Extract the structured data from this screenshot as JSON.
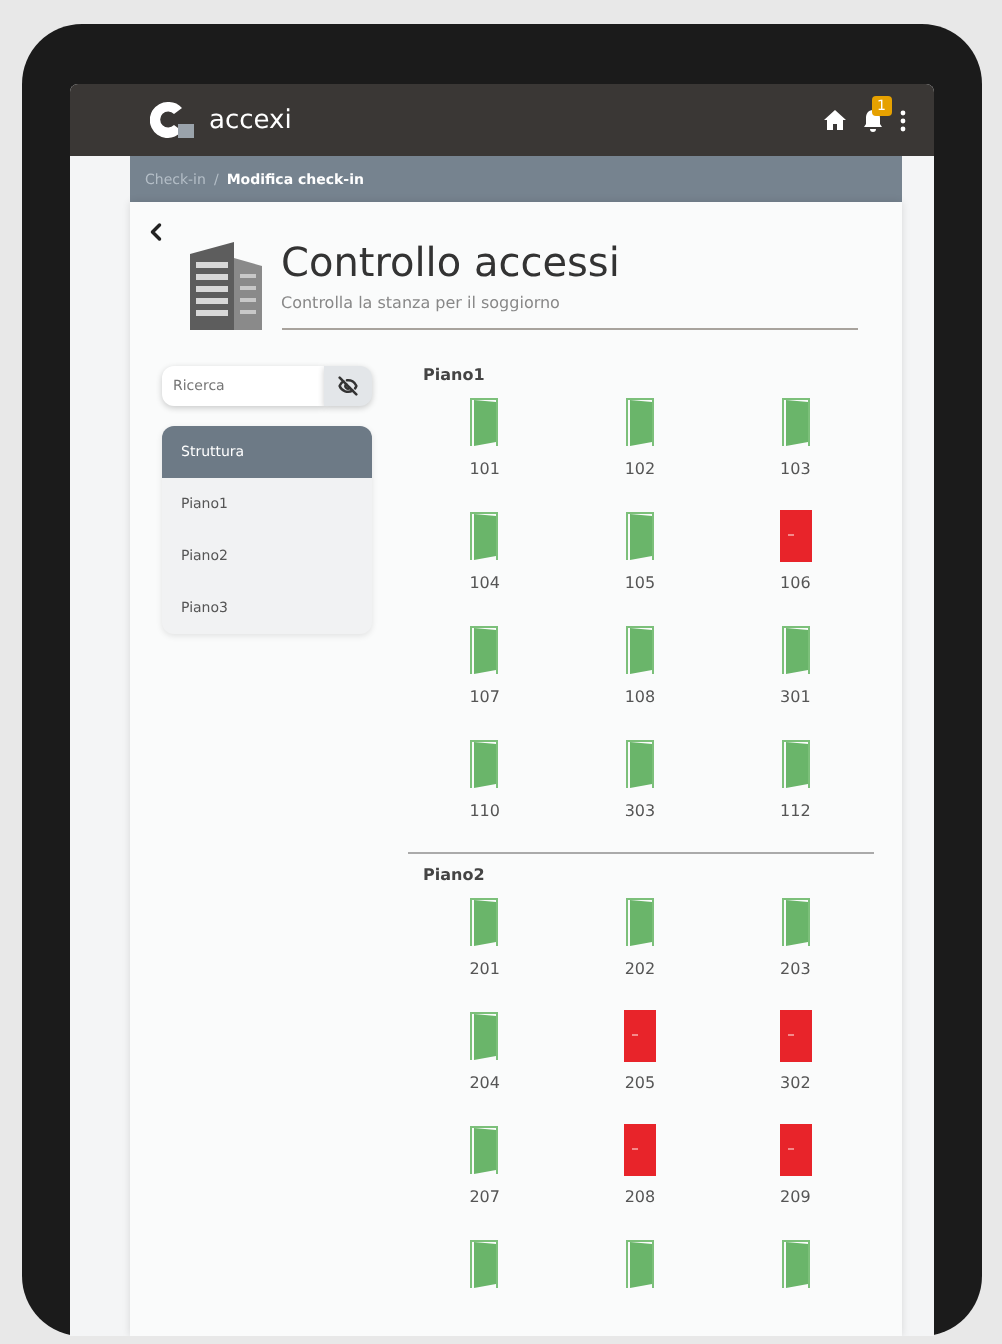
{
  "app": {
    "logo_text": "accexi",
    "notification_count": "1"
  },
  "breadcrumb_separator": "/",
  "breadcrumb": [
    {
      "label": "Check-in",
      "current": false
    },
    {
      "label": "Modifica check-in",
      "current": true
    }
  ],
  "header": {
    "title": "Controllo accessi",
    "subtitle": "Controlla la stanza per il soggiorno"
  },
  "search": {
    "placeholder": "Ricerca"
  },
  "sidebar": {
    "items": [
      {
        "label": "Struttura",
        "selected": true
      },
      {
        "label": "Piano1",
        "selected": false
      },
      {
        "label": "Piano2",
        "selected": false
      },
      {
        "label": "Piano3",
        "selected": false
      }
    ]
  },
  "floors": [
    {
      "name": "Piano1",
      "rooms": [
        {
          "number": "101",
          "open": true
        },
        {
          "number": "102",
          "open": true
        },
        {
          "number": "103",
          "open": true
        },
        {
          "number": "104",
          "open": true
        },
        {
          "number": "105",
          "open": true
        },
        {
          "number": "106",
          "open": false
        },
        {
          "number": "107",
          "open": true
        },
        {
          "number": "108",
          "open": true
        },
        {
          "number": "301",
          "open": true
        },
        {
          "number": "110",
          "open": true
        },
        {
          "number": "303",
          "open": true
        },
        {
          "number": "112",
          "open": true
        }
      ]
    },
    {
      "name": "Piano2",
      "rooms": [
        {
          "number": "201",
          "open": true
        },
        {
          "number": "202",
          "open": true
        },
        {
          "number": "203",
          "open": true
        },
        {
          "number": "204",
          "open": true
        },
        {
          "number": "205",
          "open": false
        },
        {
          "number": "302",
          "open": false
        },
        {
          "number": "207",
          "open": true
        },
        {
          "number": "208",
          "open": false
        },
        {
          "number": "209",
          "open": false
        },
        {
          "open": true
        },
        {
          "open": true
        },
        {
          "open": true
        }
      ]
    }
  ]
}
